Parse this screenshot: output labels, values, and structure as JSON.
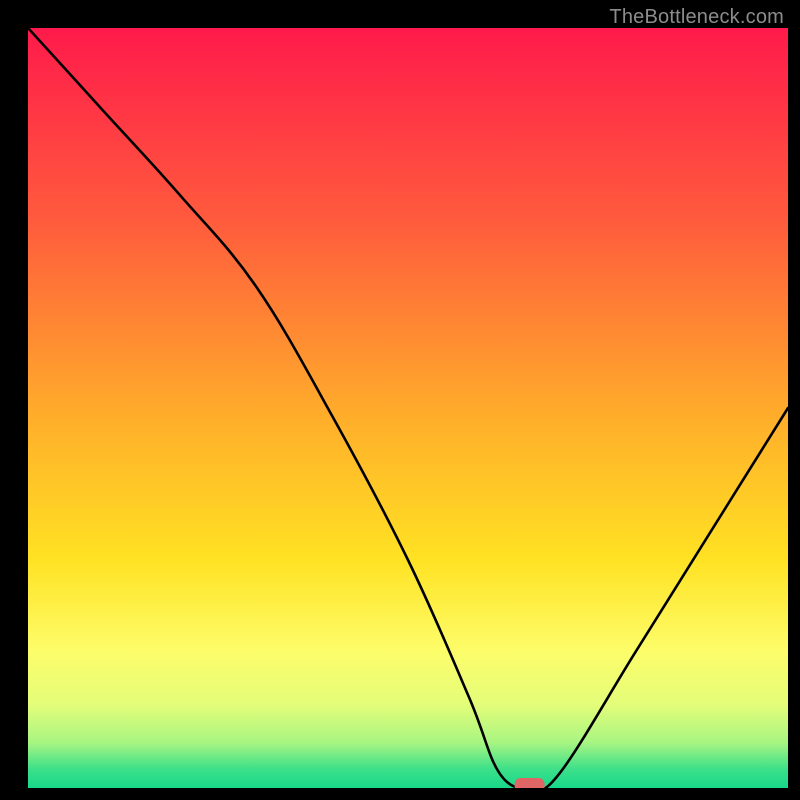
{
  "attribution": "TheBottleneck.com",
  "marker": {
    "fill": "#e06666"
  },
  "chart_data": {
    "type": "line",
    "title": "",
    "xlabel": "",
    "ylabel": "",
    "xlim": [
      0,
      100
    ],
    "ylim": [
      0,
      100
    ],
    "x": [
      0,
      10,
      20,
      30,
      40,
      50,
      58,
      62,
      66,
      70,
      80,
      90,
      100
    ],
    "values": [
      100,
      89,
      78,
      66,
      49,
      30,
      12,
      2,
      0,
      2,
      18,
      34,
      50
    ],
    "marker_point": {
      "x": 66,
      "y": 0
    },
    "gradient_stops": [
      {
        "offset": 0.0,
        "color": "#ff1a4b"
      },
      {
        "offset": 0.25,
        "color": "#ff5a3d"
      },
      {
        "offset": 0.52,
        "color": "#ffb02a"
      },
      {
        "offset": 0.7,
        "color": "#ffe223"
      },
      {
        "offset": 0.82,
        "color": "#fdfd6a"
      },
      {
        "offset": 0.89,
        "color": "#e4fd79"
      },
      {
        "offset": 0.94,
        "color": "#a8f582"
      },
      {
        "offset": 0.975,
        "color": "#3de089"
      },
      {
        "offset": 1.0,
        "color": "#17d88a"
      }
    ]
  }
}
